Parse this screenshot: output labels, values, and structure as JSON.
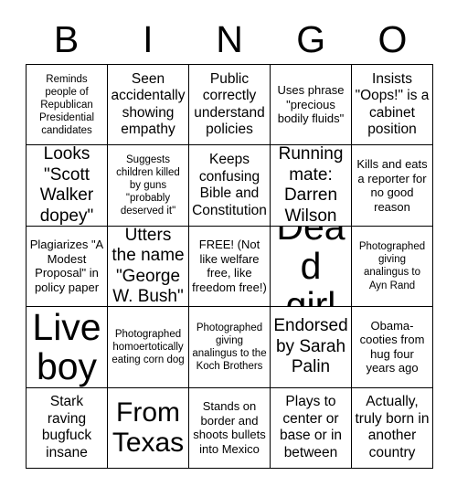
{
  "card": {
    "header_letters": [
      "B",
      "I",
      "N",
      "G",
      "O"
    ],
    "columns": 5,
    "rows": 5,
    "border_color": "#000000",
    "background_color": "#ffffff",
    "text_color": "#000000",
    "cells": [
      {
        "text": "Reminds people of Republican Presidential candidates",
        "size": "xs"
      },
      {
        "text": "Seen accidentally showing empathy",
        "size": "m"
      },
      {
        "text": "Public correctly understand policies",
        "size": "m"
      },
      {
        "text": "Uses phrase \"precious bodily fluids\"",
        "size": "s"
      },
      {
        "text": "Insists \"Oops!\" is a cabinet position",
        "size": "m"
      },
      {
        "text": "Looks \"Scott Walker dopey\"",
        "size": "l"
      },
      {
        "text": "Suggests children killed by guns \"probably deserved it\"",
        "size": "xs"
      },
      {
        "text": "Keeps confusing Bible and Constitution",
        "size": "m"
      },
      {
        "text": "Running mate: Darren Wilson",
        "size": "l"
      },
      {
        "text": "Kills and eats a reporter for no good reason",
        "size": "s"
      },
      {
        "text": "Plagiarizes \"A Modest Proposal\" in policy paper",
        "size": "s"
      },
      {
        "text": "Utters the name \"George W. Bush\"",
        "size": "l"
      },
      {
        "text": "FREE! (Not like welfare free, like freedom free!)",
        "size": "s"
      },
      {
        "text": "Dead girl",
        "size": "xxl"
      },
      {
        "text": "Photographed giving analingus to Ayn Rand",
        "size": "xs"
      },
      {
        "text": "Live boy",
        "size": "xxl"
      },
      {
        "text": "Photographed homoertotically eating corn dog",
        "size": "xs"
      },
      {
        "text": "Photographed giving analingus to the Koch Brothers",
        "size": "xs"
      },
      {
        "text": "Endorsed by Sarah Palin",
        "size": "l"
      },
      {
        "text": "Obama-cooties from hug four years ago",
        "size": "s"
      },
      {
        "text": "Stark raving bugfuck insane",
        "size": "m"
      },
      {
        "text": "From Texas",
        "size": "xl"
      },
      {
        "text": "Stands on border and shoots bullets into Mexico",
        "size": "s"
      },
      {
        "text": "Plays to center or base or in between",
        "size": "m"
      },
      {
        "text": "Actually, truly born in another country",
        "size": "m"
      }
    ]
  }
}
